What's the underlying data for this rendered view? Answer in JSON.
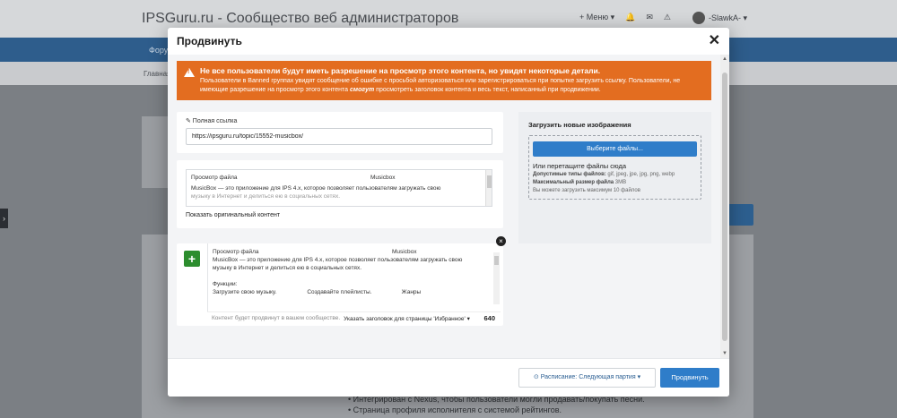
{
  "background": {
    "site_title": "IPSGuru.ru - Сообщество веб администраторов",
    "menu_label": "+ Меню ▾",
    "username": "-SlawkA- ▾",
    "nav_text": "Форум",
    "sub_text": "Главная",
    "list_lines": [
      "• Интегрирован с Nexus, чтобы пользователи могли продавать/покупать песни.",
      "• Страница профиля исполнителя с системой рейтингов."
    ]
  },
  "modal": {
    "title": "Продвинуть",
    "close_glyph": "✕",
    "warning": {
      "title": "Не все пользователи будут иметь разрешение на просмотр этого контента, но увидят некоторые детали.",
      "text_part1": "Пользователи в Banned группах увидят сообщение об ошибке с просьбой авторизоваться или зарегистрироваться при попытке загрузить ссылку. Пользователи, не имеющие разрешение на просмотр этого контента ",
      "text_bold": "смогут",
      "text_part2": " просмотреть заголовок контента и весь текст, написанный при продвижении."
    },
    "link": {
      "label": "✎ Полная ссылка",
      "value": "https://ipsguru.ru/topic/15552-musicbox/"
    },
    "original": {
      "col1": "Просмотр файла",
      "col2": "Musicbox",
      "line1": "MusicBox — это приложение для IPS 4.x, которое позволяет пользователям загружать свою",
      "line2": "музыку в Интернет и делиться ею в социальных сетях.",
      "show_link": "Показать оригинальный контент"
    },
    "promo": {
      "add_glyph": "+",
      "remove_glyph": "×",
      "col1": "Просмотр файла",
      "col2": "Musicbox",
      "line1": "MusicBox — это приложение для IPS 4.x, которое позволяет пользователям загружать свою",
      "line2": "музыку в Интернет и делиться ею в социальных сетях.",
      "functions_label": "Функции:",
      "func1": "Загрузите свою музыку.",
      "func2": "Создавайте плейлисты.",
      "func3": "Жанры",
      "footer_note": "Контент будет продвинут в вашем сообществе.",
      "footer_select": "Указать заголовок для страницы 'Избранное' ▾",
      "char_count": "640"
    },
    "upload": {
      "title": "Загрузить новые изображения",
      "choose_button": "Выберите файлы...",
      "or_drag": "Или перетащите файлы сюда",
      "allowed_label": "Допустимые типы файлов:",
      "allowed_value": " gif, jpeg, jpe, jpg, png, webp",
      "maxsize_label": "Максимальный размер файла",
      "maxsize_value": " 3MB",
      "max_files": "Вы можете загрузить максимум 10 файлов"
    },
    "footer": {
      "schedule_button": "⊙ Расписание: Следующая партия ▾",
      "promote_button": "Продвинуть"
    }
  }
}
